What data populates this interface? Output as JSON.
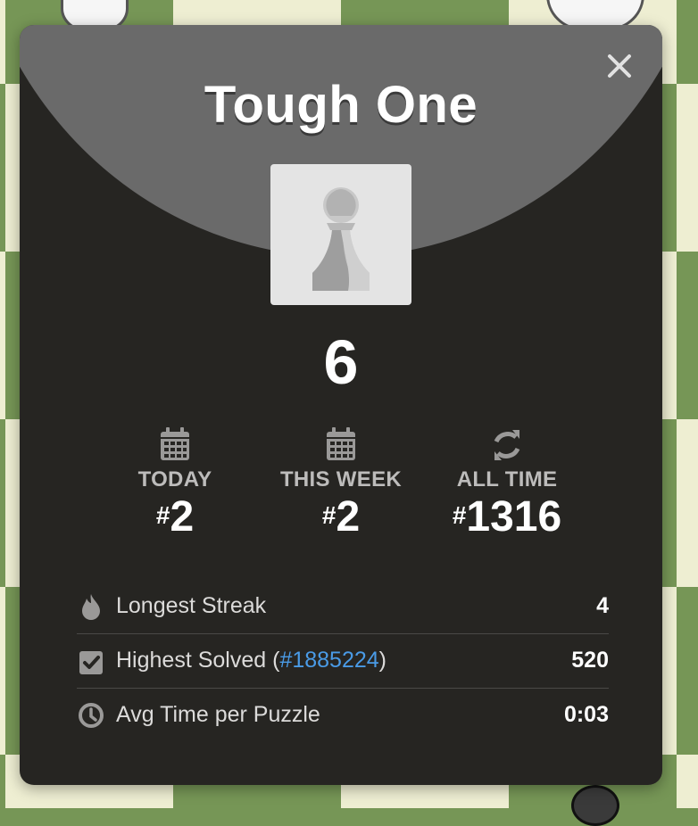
{
  "modal": {
    "title": "Tough One",
    "score": "6"
  },
  "ranks": [
    {
      "label": "TODAY",
      "hash": "#",
      "value": "2",
      "icon": "calendar-icon"
    },
    {
      "label": "THIS WEEK",
      "hash": "#",
      "value": "2",
      "icon": "calendar-icon"
    },
    {
      "label": "ALL TIME",
      "hash": "#",
      "value": "1316",
      "icon": "refresh-icon"
    }
  ],
  "stats": [
    {
      "label": "Longest Streak",
      "value": "4",
      "icon": "flame-icon"
    },
    {
      "label_prefix": "Highest Solved (",
      "link": "#1885224",
      "label_suffix": ")",
      "value": "520",
      "icon": "checkbox-icon"
    },
    {
      "label": "Avg Time per Puzzle",
      "value": "0:03",
      "icon": "clock-icon"
    }
  ],
  "colors": {
    "modal_bg": "#262522",
    "header_bg": "#6a6a6a",
    "link": "#4a9be6",
    "board_dark": "#769656",
    "board_light": "#eeeed2"
  }
}
